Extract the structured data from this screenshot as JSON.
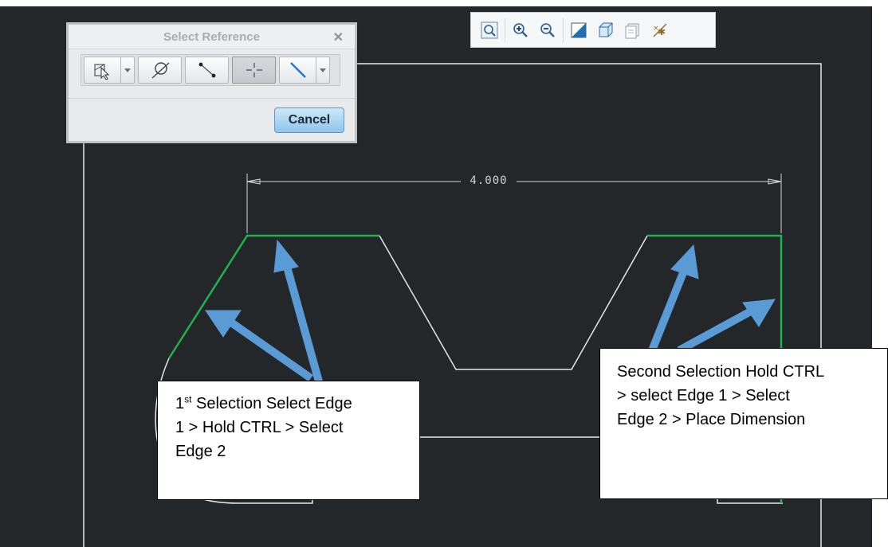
{
  "dialog": {
    "title": "Select Reference",
    "close_glyph": "✕",
    "filters": [
      "select-by-menu-icon",
      "circle-tangent-icon",
      "two-point-icon",
      "crosshair-point-icon",
      "line-icon"
    ],
    "active_filter_index": 3,
    "cancel_label": "Cancel"
  },
  "view_toolbar": {
    "icons": [
      "refit-icon",
      "zoom-in-icon",
      "zoom-out-icon",
      "repaint-icon",
      "display-style-icon",
      "saved-views-icon",
      "sketcher-display-icon"
    ]
  },
  "sketch": {
    "dimension_value": "4.000",
    "selected_color": "#22b14c",
    "line_color": "#e8e8e8",
    "background_color": "#23272a",
    "arrow_color": "#5b9bd5"
  },
  "callouts": {
    "first": {
      "sup_prefix": "1",
      "sup": "st",
      "line1_rest": " Selection Select Edge",
      "line2": "1 > Hold CTRL > Select",
      "line3": "Edge 2"
    },
    "second": {
      "line1": "Second Selection Hold CTRL",
      "line2": "> select Edge 1 > Select",
      "line3": "Edge 2 > Place Dimension"
    }
  }
}
